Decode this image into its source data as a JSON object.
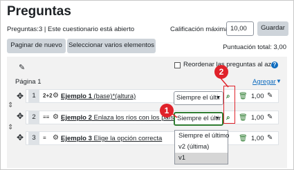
{
  "page": {
    "title": "Preguntas",
    "info": "Preguntas:3 | Este cuestionario está abierto",
    "max_grade_label": "Calificación máxima",
    "max_grade_value": "10,00",
    "save_label": "Guardar",
    "repaginate_label": "Paginar de nuevo",
    "select_multiple_label": "Seleccionar varios elementos",
    "total_score": "Puntuación total: 3,00",
    "shuffle_label": "Reordenar las preguntas al azar",
    "page_label": "Página 1",
    "add_label": "Agregar"
  },
  "questions": [
    {
      "num": "1",
      "type_icon": "2+2",
      "name_bold": "Ejemplo 1",
      "name_rest": " (base)*(altura)",
      "version": "Siempre el últir",
      "mark": "1,00"
    },
    {
      "num": "2",
      "type_icon": "≡≡",
      "name_bold": "Ejemplo 2",
      "name_rest": " Enlaza los ríos con los países",
      "version": "Siempre el últir",
      "mark": "1,00"
    },
    {
      "num": "3",
      "type_icon": "≡",
      "name_bold": "Ejemplo 3",
      "name_rest": " Elige la opción correcta",
      "version": "",
      "mark": "1,00"
    }
  ],
  "version_options": [
    "Siempre el último",
    "v2 (última)",
    "v1"
  ],
  "annotations": {
    "badge1": "1",
    "badge2": "2"
  },
  "colors": {
    "accent": "#0f6cbf",
    "annotation_red": "#e0222a",
    "focus_green": "#2f7d32"
  }
}
